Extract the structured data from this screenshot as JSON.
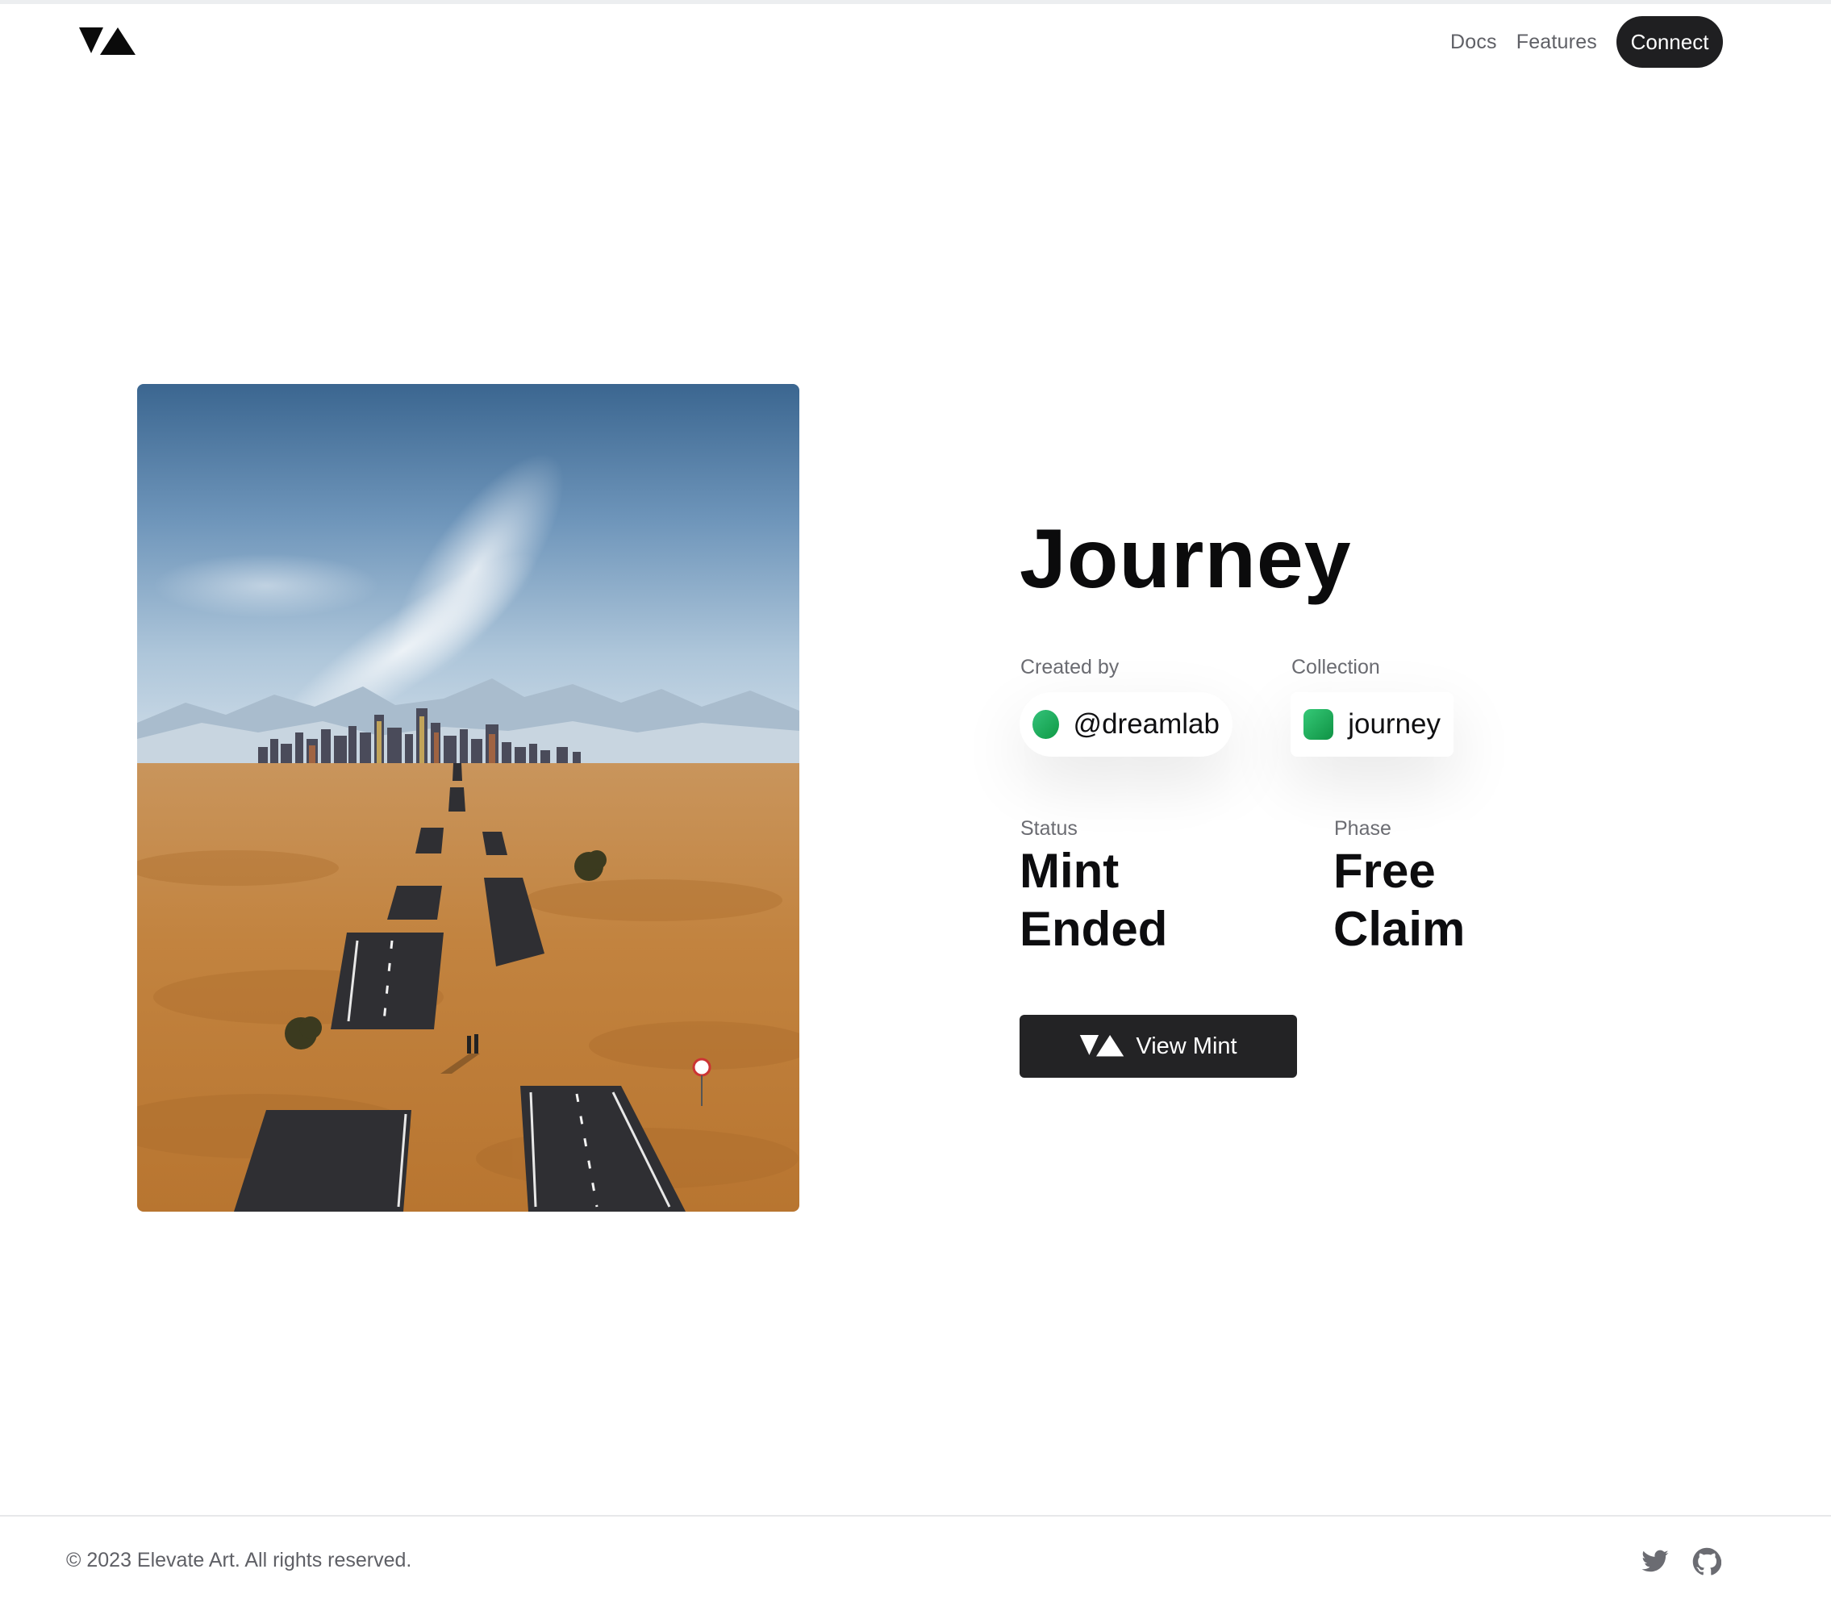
{
  "header": {
    "logo_icon": "elevate-logo-icon",
    "nav": [
      {
        "label": "Docs"
      },
      {
        "label": "Features"
      }
    ],
    "connect_label": "Connect"
  },
  "artwork": {
    "icon": "desert-city-road-artwork"
  },
  "info": {
    "title": "Journey",
    "created_by_label": "Created by",
    "creator": "@dreamlab",
    "collection_label": "Collection",
    "collection": "journey",
    "status_label": "Status",
    "status_line1": "Mint",
    "status_line2": "Ended",
    "phase_label": "Phase",
    "phase_line1": "Free",
    "phase_line2": "Claim",
    "view_mint_label": "View Mint"
  },
  "footer": {
    "copyright": "© 2023 Elevate Art. All rights reserved.",
    "social": [
      "twitter-icon",
      "github-icon"
    ]
  },
  "colors": {
    "accent_dark": "#1f1f21",
    "avatar_green": "#1aa653"
  }
}
